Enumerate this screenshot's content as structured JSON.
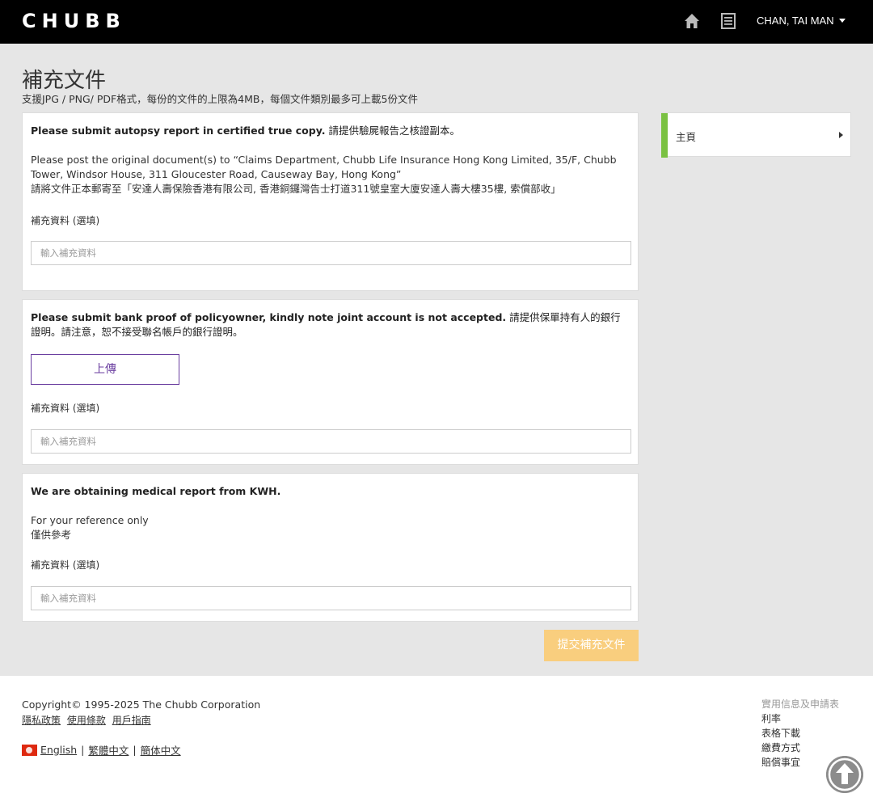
{
  "header": {
    "logo_text": "CHUBB",
    "icons": [
      "home-icon",
      "document-list-icon"
    ],
    "user_name": "CHAN, TAI MAN"
  },
  "page": {
    "title": "補充文件",
    "subtitle": "支援JPG / PNG/ PDF格式，每份的文件的上限為4MB，每個文件類別最多可上載5份文件"
  },
  "cards": [
    {
      "title_bold": "Please submit autopsy report in certified true copy.",
      "title_rest": " 請提供驗屍報告之核證副本。",
      "para_en": "Please post the original document(s) to “Claims Department, Chubb Life Insurance Hong Kong Limited, 35/F, Chubb Tower, Windsor House, 311 Gloucester Road, Causeway Bay, Hong Kong”",
      "para_zh": "請將文件正本郵寄至「安達人壽保險香港有限公司, 香港銅鑼灣告士打道311號皇室大廈安達人壽大樓35樓, 索償部收」",
      "label": "補充資料 (選填)",
      "placeholder": "輸入補充資料"
    },
    {
      "title_bold": "Please submit bank proof of policyowner, kindly note joint account is not accepted.",
      "title_rest": " 請提供保單持有人的銀行證明。請注意，恕不接受聯名帳戶的銀行證明。",
      "upload_label": "上傳",
      "label": "補充資料 (選填)",
      "placeholder": "輸入補充資料"
    },
    {
      "title_bold": "We are obtaining medical report from KWH.",
      "para_en": "For your reference only",
      "para_zh": "僅供參考",
      "label": "補充資料 (選填)",
      "placeholder": "輸入補充資料"
    }
  ],
  "submit_label": "提交補充文件",
  "sidebar": {
    "item_label": "主頁",
    "accent": "#7ac142"
  },
  "footer": {
    "copyright": "Copyright© 1995-2025 The Chubb Corporation",
    "links": [
      "隱私政策",
      "使用條款",
      "用戶指南"
    ],
    "langs": [
      "English",
      "繁體中文",
      "簡体中文"
    ],
    "lang_sep": "|",
    "right_heading": "實用信息及申請表",
    "right_links": [
      "利率",
      "表格下載",
      "繳費方式",
      "賠償事宜"
    ]
  },
  "colors": {
    "header_bg": "#000000",
    "main_bg": "#e6e6e6",
    "upload_border": "#6b3fa0",
    "submit_bg": "#f9ce7e"
  }
}
